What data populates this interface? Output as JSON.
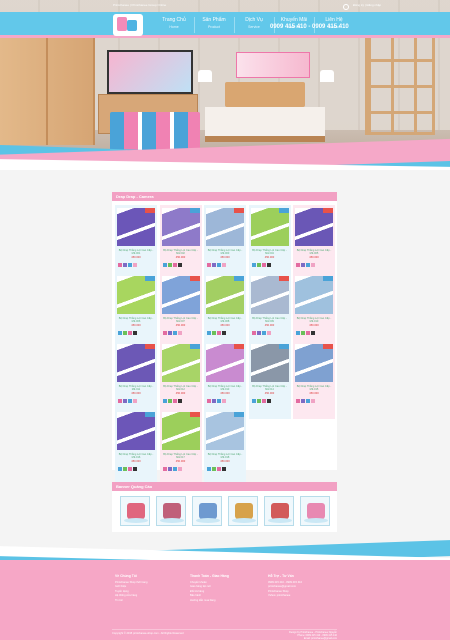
{
  "topbar": {
    "breadcrumb": "Printchanee | Printchanee Group Online",
    "hotline": "0909 415 410 - 0909 415 410",
    "lang": "Đăng ký | Đăng nhập"
  },
  "nav": [
    {
      "label": "Trang Chủ",
      "sub": "Home"
    },
    {
      "label": "Sản Phẩm",
      "sub": "Product"
    },
    {
      "label": "Dịch Vụ",
      "sub": "Service"
    },
    {
      "label": "Khuyến Mãi",
      "sub": "Sale Off"
    },
    {
      "label": "Liên Hệ",
      "sub": "Contact"
    }
  ],
  "products_section": {
    "title": "Drap Drap - Camera",
    "items": [
      {
        "name": "Bộ Drap Thắng Lợi Cao Cấp - Mã 001",
        "price": "450.000",
        "color": "#6b56b8"
      },
      {
        "name": "Bộ Drap Thắng Lợi Cao Cấp - Mã 002",
        "price": "450.000",
        "color": "#8e7ac9"
      },
      {
        "name": "Bộ Drap Thắng Lợi Cao Cấp - Mã 003",
        "price": "450.000",
        "color": "#9db7d8"
      },
      {
        "name": "Bộ Drap Thắng Lợi Cao Cấp - Mã 004",
        "price": "450.000",
        "color": "#9ccf5b"
      },
      {
        "name": "Bộ Drap Thắng Lợi Cao Cấp - Mã 005",
        "price": "450.000",
        "color": "#6a57b6"
      },
      {
        "name": "Bộ Drap Thắng Lợi Cao Cấp - Mã 006",
        "price": "450.000",
        "color": "#a8d65f"
      },
      {
        "name": "Bộ Drap Thắng Lợi Cao Cấp - Mã 007",
        "price": "450.000",
        "color": "#7fa3d9"
      },
      {
        "name": "Bộ Drap Thắng Lợi Cao Cấp - Mã 008",
        "price": "450.000",
        "color": "#a3cf63"
      },
      {
        "name": "Bộ Drap Thắng Lợi Cao Cấp - Mã 009",
        "price": "450.000",
        "color": "#a9b9d1"
      },
      {
        "name": "Bộ Drap Thắng Lợi Cao Cấp - Mã 010",
        "price": "450.000",
        "color": "#9fc1de"
      },
      {
        "name": "Bộ Drap Thắng Lợi Cao Cấp - Mã 011",
        "price": "450.000",
        "color": "#6c58b6"
      },
      {
        "name": "Bộ Drap Thắng Lợi Cao Cấp - Mã 012",
        "price": "450.000",
        "color": "#a8d467"
      },
      {
        "name": "Bộ Drap Thắng Lợi Cao Cấp - Mã 013",
        "price": "450.000",
        "color": "#c98bd0"
      },
      {
        "name": "Bộ Drap Thắng Lợi Cao Cấp - Mã 014",
        "price": "450.000",
        "color": "#8a97a8"
      },
      {
        "name": "Bộ Drap Thắng Lợi Cao Cấp - Mã 015",
        "price": "450.000",
        "color": "#7fa1d1"
      },
      {
        "name": "Bộ Drap Thắng Lợi Cao Cấp - Mã 016",
        "price": "450.000",
        "color": "#6c56b8"
      },
      {
        "name": "Bộ Drap Thắng Lợi Cao Cấp - Mã 017",
        "price": "450.000",
        "color": "#9ccf5b"
      },
      {
        "name": "Bộ Drap Thắng Lợi Cao Cấp - Mã 018",
        "price": "450.000",
        "color": "#a8c4e0"
      }
    ]
  },
  "banner_section": {
    "title": "Banner Quảng Cáo",
    "items": [
      {
        "icon": "handbag-icon",
        "color": "#e0667e"
      },
      {
        "icon": "shoe-icon",
        "color": "#c0607a"
      },
      {
        "icon": "sneaker-icon",
        "color": "#6e9ad0"
      },
      {
        "icon": "watch-icon",
        "color": "#d7a24b"
      },
      {
        "icon": "bag-icon",
        "color": "#d25a5a"
      },
      {
        "icon": "gift-icon",
        "color": "#e889b2"
      }
    ]
  },
  "footer": {
    "col1": {
      "head": "Về Chúng Tôi",
      "lines": [
        "Printchanee Shop thời trang",
        "Giới thiệu",
        "Tuyển dụng",
        "Hệ thống cửa hàng",
        "Tin tức"
      ]
    },
    "col2": {
      "head": "Thanh Toán - Giao Hàng",
      "lines": [
        "Chuyển khoản",
        "Giao hàng tận nơi",
        "Đổi trả hàng",
        "Bảo hành",
        "Hướng dẫn mua hàng"
      ]
    },
    "col3": {
      "head": "Hỗ Trợ - Tư Vấn",
      "lines": [
        "0909 415 410 - 0909 415 410",
        "printchanee@gmail.com",
        "Printchanee Shop",
        "Yahoo: printchanee"
      ]
    },
    "copyright": "Copyright © 2015 printchanee-shop.com - All Rights Reserved",
    "credit_line1": "Design by Printchanee - Printchanee Nguyễn",
    "credit_line2": "Phone: 0909 415 410 - 0909 415 410",
    "credit_line3": "Email: printchanee@gmail.com"
  },
  "colors": {
    "blue": "#5cc3e6",
    "pink": "#f5a8c8"
  }
}
